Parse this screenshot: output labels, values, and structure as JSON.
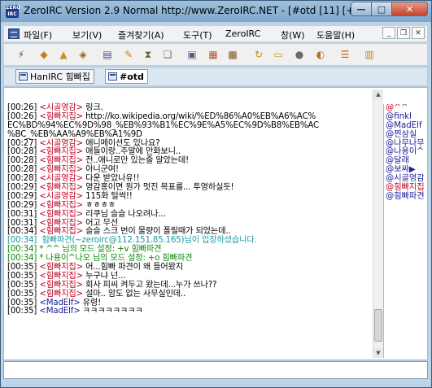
{
  "window": {
    "title": "ZeroIRC Version 2.9 Normal http://www.ZeroIRC.NET - [#otd [11] [+ns...",
    "icon_text": "ZERO IRC",
    "controls": {
      "minimize": "—",
      "maximize": "□",
      "close": "✕"
    }
  },
  "menu": {
    "items": [
      "파일(F)",
      "보기(V)",
      "즐겨찾기(A)",
      "도구(T)",
      "ZeroIRC",
      "창(W)",
      "도움말(H)"
    ],
    "mdi_controls": [
      "_",
      "❐",
      "✕"
    ]
  },
  "toolbar": {
    "buttons": [
      {
        "icon": "connect-icon",
        "glyph": "⚡",
        "color": "#6a4a1a"
      },
      {
        "icon": "channel-icon",
        "glyph": "◆",
        "color": "#c08010"
      },
      {
        "icon": "server-icon",
        "glyph": "▲",
        "color": "#d09020"
      },
      {
        "icon": "options-icon",
        "glyph": "◈",
        "color": "#a06010"
      },
      {
        "icon": "list-icon",
        "glyph": "▤",
        "color": "#405080"
      },
      {
        "icon": "edit-icon",
        "glyph": "✎",
        "color": "#d08000"
      },
      {
        "icon": "timer-icon",
        "glyph": "⧗",
        "color": "#507040"
      },
      {
        "icon": "copy-icon",
        "glyph": "❏",
        "color": "#707070"
      },
      {
        "icon": "document-icon",
        "glyph": "▣",
        "color": "#506080"
      },
      {
        "icon": "dcc-icon",
        "glyph": "▦",
        "color": "#c05030"
      },
      {
        "icon": "notify-icon",
        "glyph": "▩",
        "color": "#805020"
      },
      {
        "icon": "refresh-icon",
        "glyph": "↻",
        "color": "#c09000"
      },
      {
        "icon": "folder-icon",
        "glyph": "▭",
        "color": "#d0a020"
      },
      {
        "icon": "palette-icon",
        "glyph": "●",
        "color": "#6a6a6a"
      },
      {
        "icon": "font-icon",
        "glyph": "◐",
        "color": "#b07020"
      },
      {
        "icon": "tile-horizontal-icon",
        "glyph": "☰",
        "color": "#d06000"
      },
      {
        "icon": "tile-vertical-icon",
        "glyph": "▥",
        "color": "#d08000"
      }
    ]
  },
  "tabs": [
    {
      "label": "HanIRC 힘빠집",
      "active": false
    },
    {
      "label": "#otd",
      "active": true
    }
  ],
  "messages": [
    {
      "time": "[00:26] ",
      "nick": "<시골영감>",
      "nick_color": "red",
      "text": " 링크."
    },
    {
      "time": "[00:26] ",
      "nick": "<힘빠지집>",
      "nick_color": "red",
      "text": " http://ko.wikipedia.org/wiki/%ED%86%A0%EB%A6%AC%"
    },
    {
      "time": "",
      "nick": "",
      "nick_color": "",
      "text": "EC%BD%94%EC%9D%98_%EB%93%B1%EC%9E%A5%EC%9D%B8%EB%AC"
    },
    {
      "time": "",
      "nick": "",
      "nick_color": "",
      "text": "%BC_%EB%AA%A9%EB%A1%9D"
    },
    {
      "time": "[00:27] ",
      "nick": "<시골영감>",
      "nick_color": "red",
      "text": " 애니메이션도 있나요?"
    },
    {
      "time": "[00:28] ",
      "nick": "<힘빠지집>",
      "nick_color": "red",
      "text": " 애들이랑..주말에 만화보니.."
    },
    {
      "time": "[00:28] ",
      "nick": "<힘빠지집>",
      "nick_color": "red",
      "text": " 전..애니로만 있는줄 알았는데!"
    },
    {
      "time": "[00:28] ",
      "nick": "<힘빠지집>",
      "nick_color": "red",
      "text": " 아니군여!"
    },
    {
      "time": "[00:28] ",
      "nick": "<시골영감>",
      "nick_color": "red",
      "text": " 다운 받았나유!!"
    },
    {
      "time": "[00:29] ",
      "nick": "<힘빠지집>",
      "nick_color": "red",
      "text": " 영감홍이면 뭔가 멋진 목표를... 투영하실듯!"
    },
    {
      "time": "[00:29] ",
      "nick": "<시골영감>",
      "nick_color": "red",
      "text": " 115화 털썩!!"
    },
    {
      "time": "[00:29] ",
      "nick": "<힘빠지집>",
      "nick_color": "red",
      "text": " ㅎㅎㅎㅎ"
    },
    {
      "time": "[00:31] ",
      "nick": "<힘빠지집>",
      "nick_color": "red",
      "text": " 리쿠님 슬슬 나오려나..."
    },
    {
      "time": "[00:31] ",
      "nick": "<힘빠지집>",
      "nick_color": "red",
      "text": " 어고 무선"
    },
    {
      "time": "[00:34] ",
      "nick": "<힘빠지집>",
      "nick_color": "red",
      "text": " 슬슬 스크 번이 물량이 폴릴때가 되었는데.."
    },
    {
      "time": "",
      "nick": "",
      "nick_color": "",
      "text": "[00:34]  힘빠파견(~zeroirc@112.151.85.165)님이 입장하셨습니다.",
      "kind": "join"
    },
    {
      "time": "",
      "nick": "",
      "nick_color": "",
      "text": "[00:34] * ^^ 님의 모드 설정: +v 힘빠파견",
      "kind": "mode"
    },
    {
      "time": "",
      "nick": "",
      "nick_color": "",
      "text": "[00:34] * 나용이^나오 님의 모드 설정: +o 힘빠파견",
      "kind": "mode"
    },
    {
      "time": "[00:35] ",
      "nick": "<힘빠지집>",
      "nick_color": "red",
      "text": " 어...힘빠 파견이 왜 들어왔지"
    },
    {
      "time": "[00:35] ",
      "nick": "<힘빠지집>",
      "nick_color": "red",
      "text": " 누구냐 넌..."
    },
    {
      "time": "[00:35] ",
      "nick": "<힘빠지집>",
      "nick_color": "red",
      "text": " 회사 피씨 켜두고 왔는데...누가 쓰나??"
    },
    {
      "time": "[00:35] ",
      "nick": "<힘빠지집>",
      "nick_color": "red",
      "text": " 설마.. 암도 없는 사무실인데.."
    },
    {
      "time": "[00:35] ",
      "nick": "<MadElf>",
      "nick_color": "blue",
      "text": " 유령!"
    },
    {
      "time": "[00:35] ",
      "nick": "<MadElf>",
      "nick_color": "blue",
      "text": " ㅋㅋㅋㅋㅋㅋㅋㅋ"
    }
  ],
  "nicklist": [
    {
      "name": "@^^",
      "op": true
    },
    {
      "name": "@finkl",
      "op": false
    },
    {
      "name": "@MadElf",
      "op": false
    },
    {
      "name": "@찐삼실",
      "op": false
    },
    {
      "name": "@나무나무",
      "op": false
    },
    {
      "name": "@나용이^",
      "op": false
    },
    {
      "name": "@달래",
      "op": false
    },
    {
      "name": "@보싸▶",
      "op": false
    },
    {
      "name": "@시골영감",
      "op": false
    },
    {
      "name": "@힘빠지집",
      "op": true
    },
    {
      "name": "@힘빠파견",
      "op": false
    }
  ],
  "input": {
    "value": "",
    "placeholder": ""
  }
}
